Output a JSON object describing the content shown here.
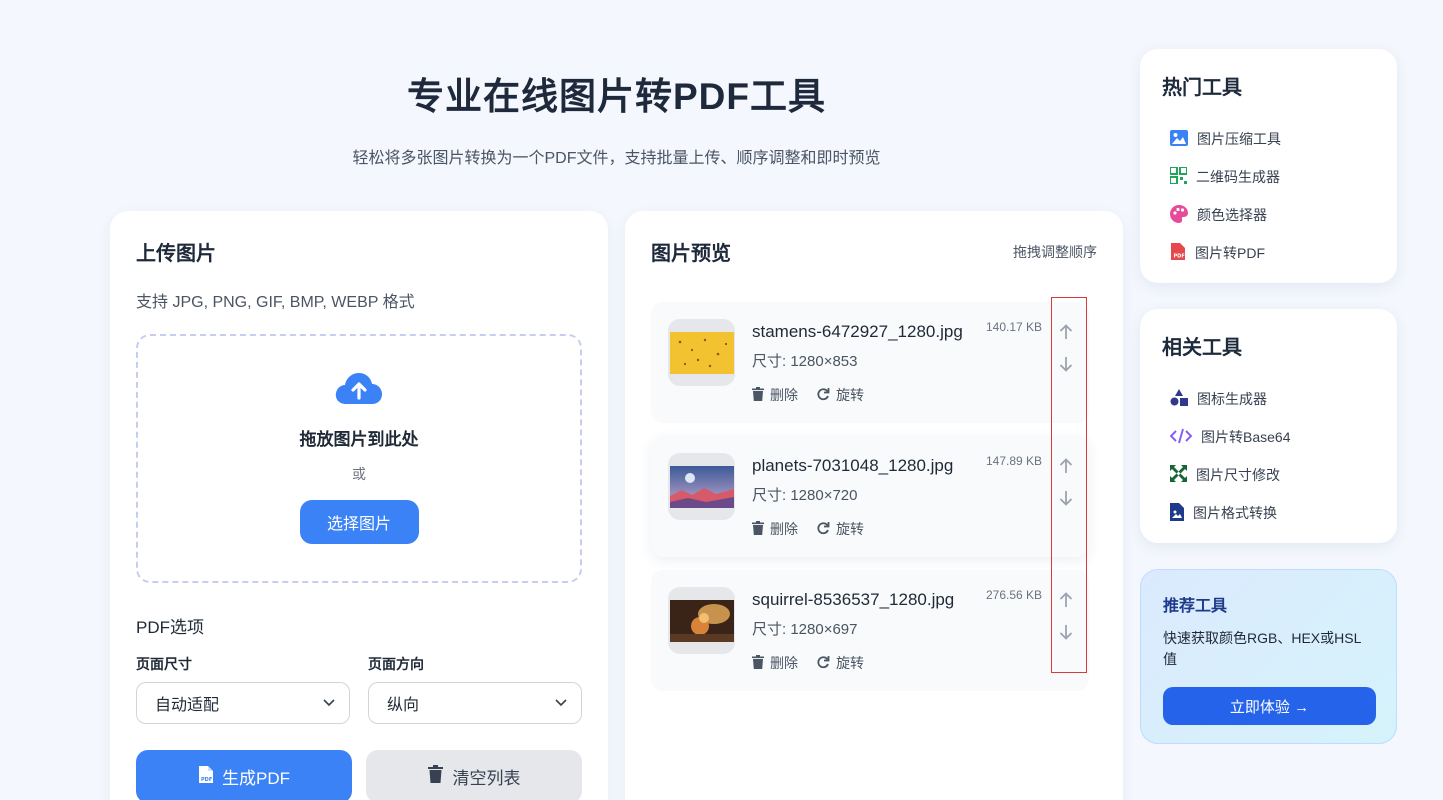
{
  "hero": {
    "title": "专业在线图片转PDF工具",
    "subtitle": "轻松将多张图片转换为一个PDF文件，支持批量上传、顺序调整和即时预览"
  },
  "upload": {
    "title": "上传图片",
    "formats": "支持 JPG, PNG, GIF, BMP, WEBP 格式",
    "drop_text": "拖放图片到此处",
    "or_text": "或",
    "select_button": "选择图片",
    "options_label": "PDF选项",
    "page_size_label": "页面尺寸",
    "page_size_value": "自动适配",
    "orientation_label": "页面方向",
    "orientation_value": "纵向",
    "generate_button": "生成PDF",
    "clear_button": "清空列表"
  },
  "preview": {
    "title": "图片预览",
    "hint": "拖拽调整顺序",
    "delete_label": "删除",
    "rotate_label": "旋转",
    "items": [
      {
        "filename": "stamens-6472927_1280.jpg",
        "dims": "尺寸: 1280×853",
        "size": "140.17 KB"
      },
      {
        "filename": "planets-7031048_1280.jpg",
        "dims": "尺寸: 1280×720",
        "size": "147.89 KB"
      },
      {
        "filename": "squirrel-8536537_1280.jpg",
        "dims": "尺寸: 1280×697",
        "size": "276.56 KB"
      }
    ]
  },
  "hot_tools": {
    "title": "热门工具",
    "items": [
      {
        "label": "图片压缩工具",
        "icon": "image-icon"
      },
      {
        "label": "二维码生成器",
        "icon": "qrcode-icon"
      },
      {
        "label": "颜色选择器",
        "icon": "palette-icon"
      },
      {
        "label": "图片转PDF",
        "icon": "pdf-file-icon"
      }
    ]
  },
  "related_tools": {
    "title": "相关工具",
    "items": [
      {
        "label": "图标生成器",
        "icon": "shapes-icon"
      },
      {
        "label": "图片转Base64",
        "icon": "code-icon"
      },
      {
        "label": "图片尺寸修改",
        "icon": "resize-icon"
      },
      {
        "label": "图片格式转换",
        "icon": "image-file-icon"
      }
    ]
  },
  "recommend": {
    "title": "推荐工具",
    "desc": "快速获取颜色RGB、HEX或HSL值",
    "button": "立即体验 →"
  },
  "colors": {
    "primary": "#3b82f6",
    "cta": "#2563eb",
    "text": "#1e2a3b",
    "highlight_box": "#d83a3a"
  }
}
